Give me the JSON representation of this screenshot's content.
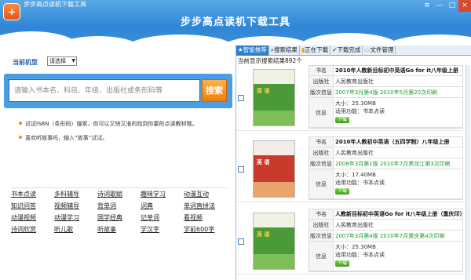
{
  "window": {
    "title": "步步高点读机下载工具",
    "banner_title": "步步高点读机下载工具",
    "controls": [
      "≡",
      "—",
      "□",
      "×"
    ]
  },
  "left": {
    "model_label": "当前机型",
    "model_value": "请选择",
    "search_placeholder": "请输入书本名、科目、年级、出版社或条形码等",
    "search_button": "搜索",
    "tip1": "试试ISBN（条形码）搜索，你可以又快又准的找到你要的点读教材哦。",
    "tip2": "喜欢听故事吗，输入“故事”试试。",
    "links": [
      [
        "书本点读",
        "多科辅导",
        "诗词歌赋",
        "趣味学习",
        "动漫互动"
      ],
      [
        "知识问答",
        "视频辅导",
        "背单词",
        "词典",
        "单词直拼法"
      ],
      [
        "动漫视频",
        "动漫学习",
        "国学经典",
        "记单词",
        "看视频"
      ],
      [
        "诗词欣赏",
        "听儿歌",
        "听故事",
        "学汉字",
        "学前600字"
      ]
    ]
  },
  "right": {
    "tabs": [
      "智能推荐",
      "搜索结果",
      "正在下载",
      "下载完成",
      "文件管理"
    ],
    "result_count": "当前显示搜索结果892个",
    "labels": {
      "name": "书名",
      "publisher": "出版社",
      "version": "版次信息",
      "info": "信息"
    },
    "download_label": "下载",
    "books": [
      {
        "name": "2010年人教新目标初中英语Go for it八年级上册",
        "publisher": "人民教育出版社",
        "version": "2007年3月第4版 2010年5月第20次印刷",
        "size": "大小：25.30MB",
        "func": "适用功能：书本点读",
        "cover_color": "#3a8f3a"
      },
      {
        "name": "2010年人教初中英语（五四学制）八年级上册",
        "publisher": "人民教育出版社",
        "version": "2008年3月第1版 2010年7月黑龙江第3次印刷",
        "size": "大小：17.40MB",
        "func": "适用功能：书本点读",
        "cover_color": "#c0392b"
      },
      {
        "name": "人教新目标初中英语Go for it八年级上册（重庆印）",
        "publisher": "人民教育出版社",
        "version": "2007年3月第4版 2010年7月重庆第4次印刷",
        "size": "大小：25.30MB",
        "func": "适用功能：书本点读",
        "cover_color": "#3a8f3a"
      }
    ]
  }
}
